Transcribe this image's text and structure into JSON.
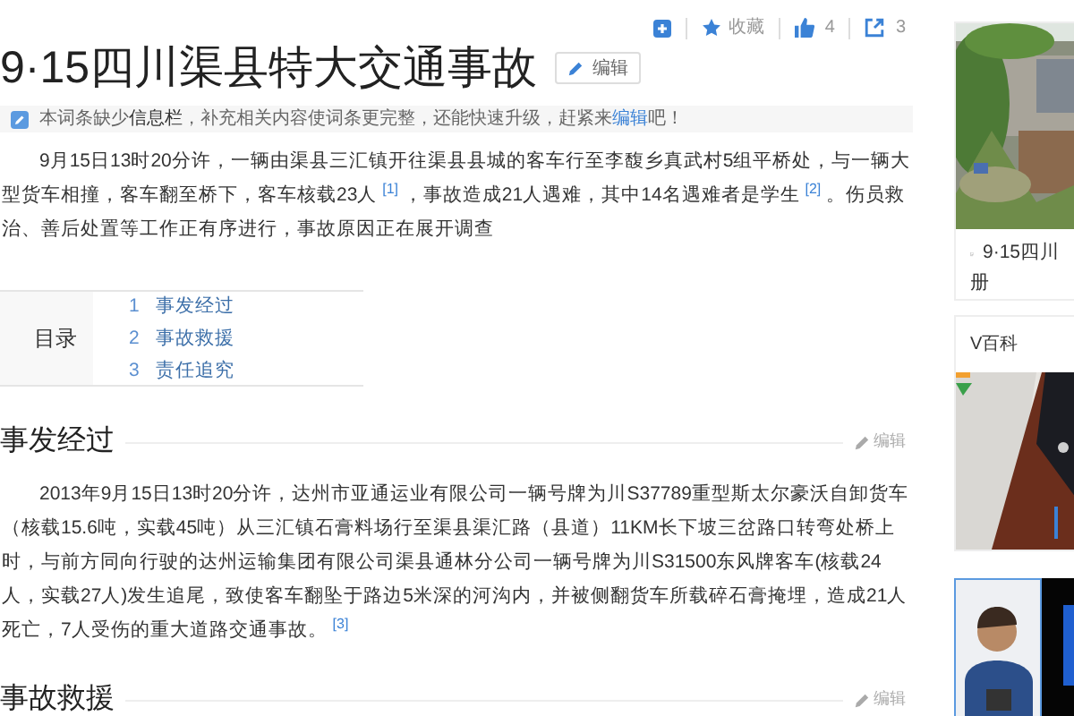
{
  "toolbar": {
    "favorite": "收藏",
    "likes": "4",
    "shares": "3"
  },
  "title": "9·15四川渠县特大交通事故",
  "title_edit": "编辑",
  "notice": {
    "before": "本词条缺少**信息栏**，补充相关内容使词条更完整，还能快速升级，赶紧来",
    "link": "编辑",
    "after": "吧！"
  },
  "intro": "9月15日13时20分许，一辆由渠县三汇镇开往渠县县城的客车行至李馥乡真武村5组平桥处，与一辆大型货车相撞，客车翻至桥下，客车核载23人 $^{[1]}$ ，事故造成21人遇难，其中14名遇难者是学生 $^{[2]}$ 。伤员救治、善后处置等工作正有序进行，事故原因正在展开调查",
  "toc": {
    "label": "目录",
    "items": [
      {
        "number": "1",
        "text": "事发经过"
      },
      {
        "number": "2",
        "text": "事故救援"
      },
      {
        "number": "3",
        "text": "责任追究"
      }
    ]
  },
  "sections": [
    {
      "heading": "事发经过",
      "edit": "编辑",
      "text": "2013年9月15日13时20分许，达州市亚通运业有限公司一辆号牌为川S37789重型斯太尔豪沃自卸货车（核载15.6吨，实载45吨）从三汇镇石膏料场行至渠县渠汇路（县道）11KM长下坡三岔路口转弯处桥上时，与前方同向行驶的达州运输集团有限公司渠县通林分公司一辆号牌为川S31500东风牌客车(核载24人，实载27人)发生追尾，致使客车翻坠于路边5米深的河沟内，并被侧翻货车所载碎石膏掩埋，造成21人死亡，7人受伤的重大道路交通事故。 $^{[3]}$"
    },
    {
      "heading": "事故救援",
      "edit": "编辑"
    }
  ],
  "sidebar": {
    "album_caption_1": "9·15四川",
    "album_caption_2": "册",
    "vbaike": "V百科"
  }
}
